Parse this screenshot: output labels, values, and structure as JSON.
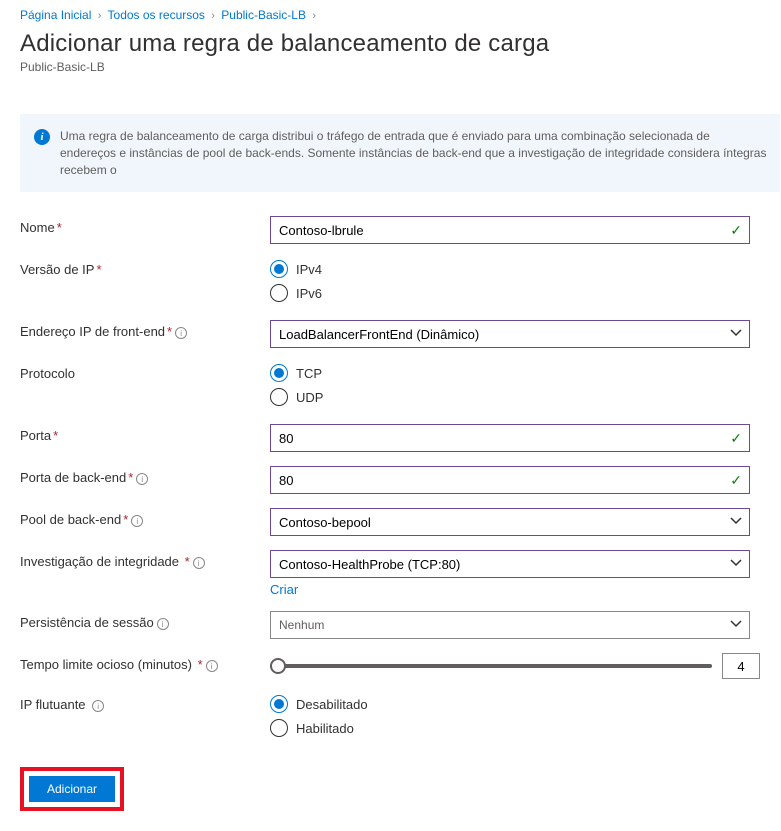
{
  "breadcrumb": {
    "home": "Página Inicial",
    "all": "Todos os recursos",
    "resource": "Public-Basic-LB"
  },
  "header": {
    "title": "Adicionar uma regra de balanceamento de carga",
    "subtitle": "Public-Basic-LB"
  },
  "info": "Uma regra de balanceamento de carga distribui o tráfego de entrada que é enviado para uma combinação selecionada de endereços e instâncias de pool de back-ends. Somente instâncias de back-end que a investigação de integridade considera íntegras recebem o",
  "labels": {
    "name": "Nome",
    "ipversion": "Versão de IP",
    "frontend": "Endereço IP de front-end",
    "protocol": "Protocolo",
    "port": "Porta",
    "backendport": "Porta de back-end",
    "backendpool": "Pool de back-end",
    "healthprobe": "Investigação de integridade",
    "sessionpers": "Persistência de sessão",
    "idletimeout": "Tempo limite ocioso (minutos)",
    "floatingip": "IP flutuante"
  },
  "values": {
    "name": "Contoso-lbrule",
    "ipv4": "IPv4",
    "ipv6": "IPv6",
    "frontend": "LoadBalancerFrontEnd (Dinâmico)",
    "tcp": "TCP",
    "udp": "UDP",
    "port": "80",
    "backendport": "80",
    "backendpool": "Contoso-bepool",
    "healthprobe": "Contoso-HealthProbe (TCP:80)",
    "createlink": "Criar",
    "sessionpers": "Nenhum",
    "idletimeout": "4",
    "disabled": "Desabilitado",
    "enabled": "Habilitado"
  },
  "buttons": {
    "add": "Adicionar"
  }
}
